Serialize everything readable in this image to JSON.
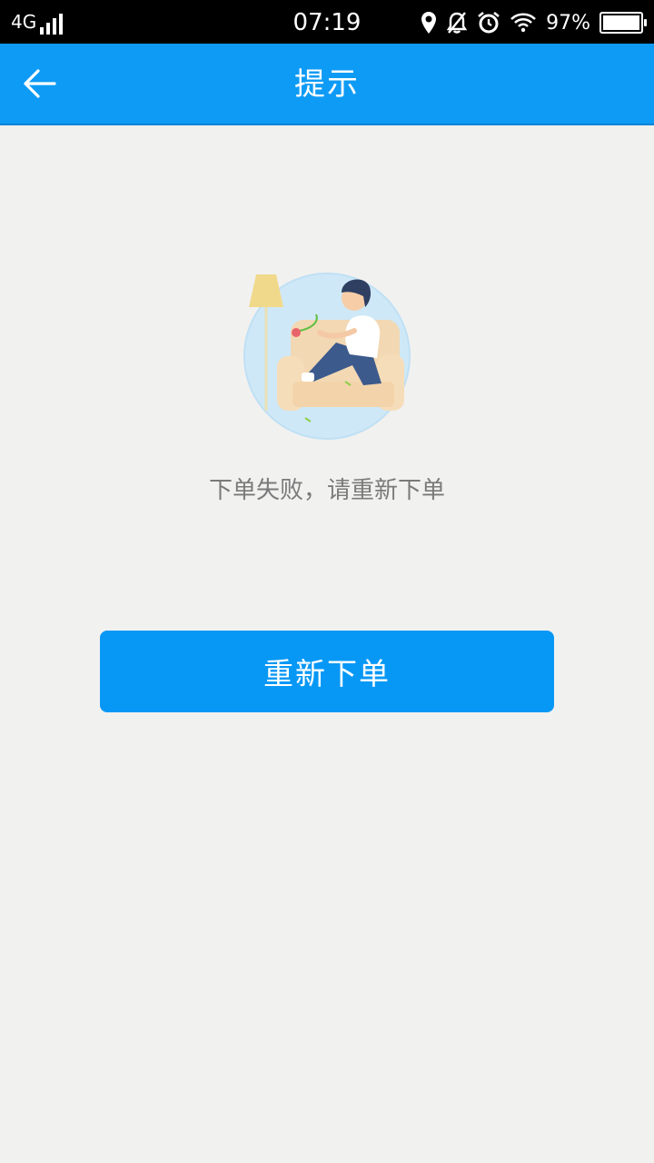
{
  "status_bar": {
    "network": "4G",
    "time": "07:19",
    "battery_percent": "97%",
    "icons": [
      "signal-icon",
      "location-icon",
      "mute-icon",
      "alarm-icon",
      "wifi-icon",
      "battery-icon"
    ]
  },
  "app_bar": {
    "title": "提示",
    "back_icon": "arrow-left-icon",
    "background": "#0e9bf5"
  },
  "content": {
    "illustration": "person-on-sofa-illustration",
    "message": "下单失败，请重新下单",
    "button_label": "重新下单",
    "button_color": "#0798f5"
  }
}
